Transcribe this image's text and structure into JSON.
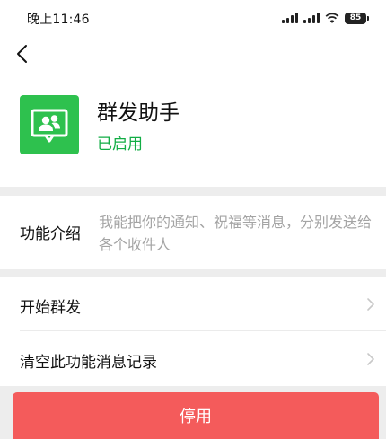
{
  "status_bar": {
    "time": "晚上11:46",
    "battery": "85"
  },
  "nav": {
    "back_icon": "chevron-left-icon"
  },
  "app": {
    "icon": "group-message-icon",
    "icon_color": "#2ec14e",
    "title": "群发助手",
    "status": "已启用",
    "status_color": "#12ad45"
  },
  "intro": {
    "label": "功能介绍",
    "text": "我能把你的通知、祝福等消息，分别发送给各个收件人"
  },
  "menu": {
    "items": [
      {
        "label": "开始群发"
      },
      {
        "label": "清空此功能消息记录"
      }
    ]
  },
  "action": {
    "disable_label": "停用",
    "color": "#f45b5b"
  }
}
